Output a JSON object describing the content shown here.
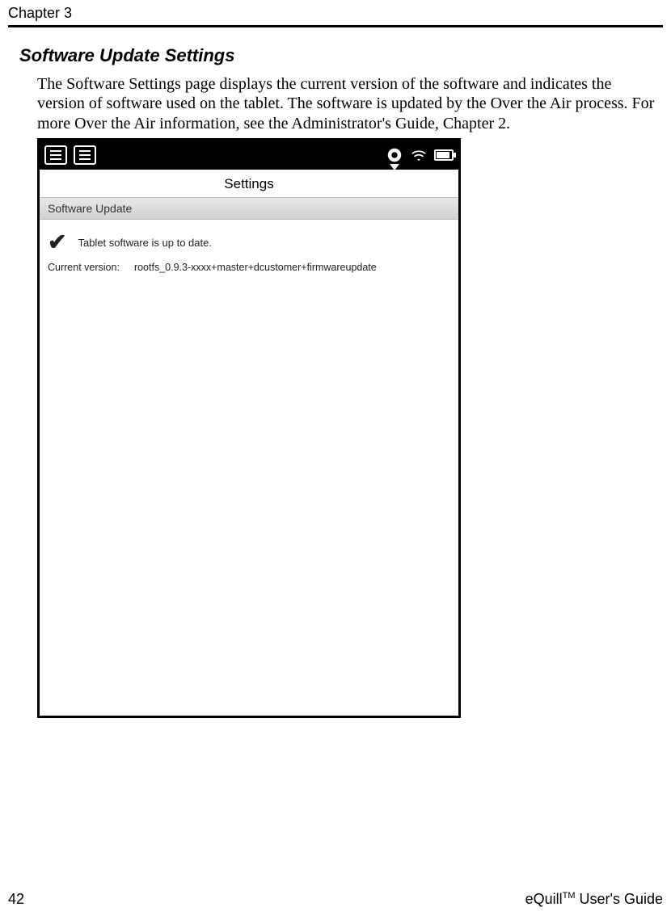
{
  "header": {
    "chapter": "Chapter 3"
  },
  "section": {
    "title": "Software Update Settings",
    "body": "The Software Settings page displays the current version of the software and indicates the version of software used on the tablet. The software is updated by the Over the Air process. For more Over the Air information, see the Administrator's Guide, Chapter 2."
  },
  "screenshot": {
    "title": "Settings",
    "subheader": "Software Update",
    "status_text": "Tablet software is up to date.",
    "version_label": "Current version:",
    "version_value": "rootfs_0.9.3-xxxx+master+dcustomer+firmwareupdate"
  },
  "footer": {
    "page_number": "42",
    "guide_prefix": "eQuill",
    "guide_tm": "TM",
    "guide_suffix": " User's Guide"
  }
}
